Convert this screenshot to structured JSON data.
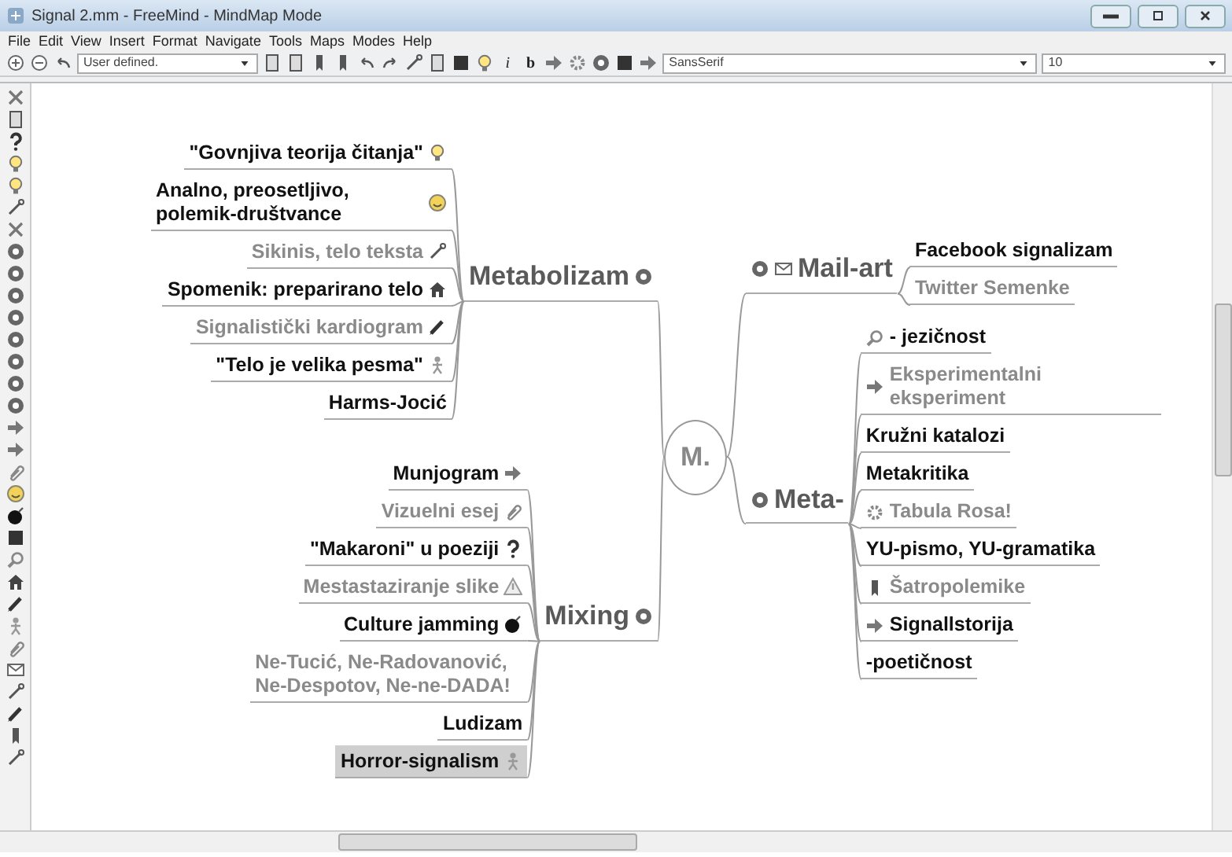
{
  "window": {
    "title": "Signal 2.mm - FreeMind - MindMap Mode"
  },
  "menu": [
    "File",
    "Edit",
    "View",
    "Insert",
    "Format",
    "Navigate",
    "Tools",
    "Maps",
    "Modes",
    "Help"
  ],
  "toolbar": {
    "zoom_preset": "User defined.",
    "italic_button": "i",
    "bold_button": "b",
    "font_family": "SansSerif",
    "font_size": "10"
  },
  "map": {
    "root": {
      "text": "M.",
      "selected": false
    },
    "left": [
      {
        "text": "Metabolizam",
        "selected": false,
        "children": [
          {
            "text": "\"Govnjiva teorija čitanja\"",
            "faded": false,
            "selected": false
          },
          {
            "text": "Analno, preosetljivo, polemik-društvance",
            "faded": false,
            "selected": false
          },
          {
            "text": "Sikinis, telo teksta",
            "faded": true,
            "selected": false
          },
          {
            "text": "Spomenik: preparirano telo",
            "faded": false,
            "selected": false
          },
          {
            "text": "Signalistički kardiogram",
            "faded": true,
            "selected": false
          },
          {
            "text": "\"Telo je velika pesma\"",
            "faded": false,
            "selected": false
          },
          {
            "text": "Harms-Jocić",
            "faded": false,
            "selected": false
          }
        ]
      },
      {
        "text": "Mixing",
        "selected": false,
        "children": [
          {
            "text": "Munjogram",
            "faded": false,
            "selected": false
          },
          {
            "text": "Vizuelni esej",
            "faded": true,
            "selected": false
          },
          {
            "text": "\"Makaroni\" u poeziji",
            "faded": false,
            "selected": false
          },
          {
            "text": "Mestastaziranje slike",
            "faded": true,
            "selected": false
          },
          {
            "text": "Culture jamming",
            "faded": false,
            "selected": false
          },
          {
            "text": "Ne-Tucić, Ne-Radovanović, Ne-Despotov, Ne-ne-DADA!",
            "faded": true,
            "selected": false
          },
          {
            "text": "Ludizam",
            "faded": false,
            "selected": false
          },
          {
            "text": "Horror-signalism",
            "faded": false,
            "selected": true
          }
        ]
      }
    ],
    "right": [
      {
        "text": "Mail-art",
        "selected": false,
        "children": [
          {
            "text": "Facebook signalizam",
            "faded": false,
            "selected": false
          },
          {
            "text": "Twitter Semenke",
            "faded": true,
            "selected": false
          }
        ]
      },
      {
        "text": "Meta-",
        "selected": false,
        "children": [
          {
            "text": "- jezičnost",
            "faded": false,
            "selected": false
          },
          {
            "text": "Eksperimentalni eksperiment",
            "faded": true,
            "selected": false
          },
          {
            "text": "Kružni katalozi",
            "faded": false,
            "selected": false
          },
          {
            "text": "Metakritika",
            "faded": false,
            "selected": false
          },
          {
            "text": "Tabula Rosa!",
            "faded": true,
            "selected": false
          },
          {
            "text": "YU-pismo, YU-gramatika",
            "faded": false,
            "selected": false
          },
          {
            "text": "Šatropolemike",
            "faded": true,
            "selected": false
          },
          {
            "text": "Signallstorija",
            "faded": false,
            "selected": false
          },
          {
            "text": "-poetičnost",
            "faded": false,
            "selected": false
          }
        ]
      }
    ]
  }
}
